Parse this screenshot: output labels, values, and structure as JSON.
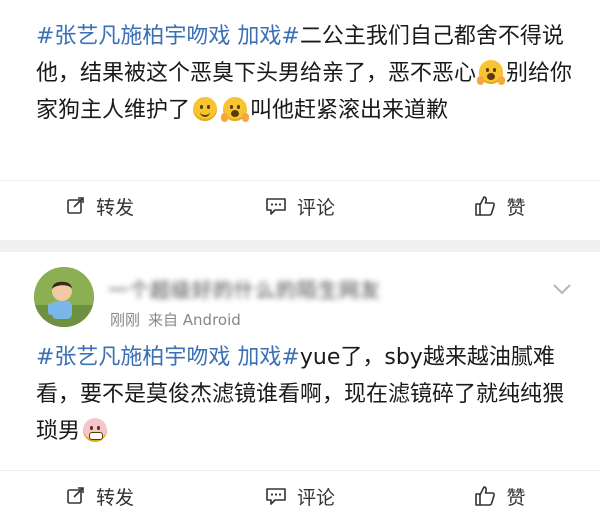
{
  "post1": {
    "tag": "#张艺凡施柏宇吻戏 加戏#",
    "text_a": "二公主我们自己都舍不得说他，结果被这个恶臭下头男给亲了，恶不恶心",
    "text_b": "别给你家狗主人维护了",
    "text_c": "叫他赶紧滚出来道歉",
    "actions": {
      "repost": "转发",
      "comment": "评论",
      "like": "赞"
    }
  },
  "post2": {
    "username": "一个超级好的什么的陌生网友",
    "time": "刚刚",
    "source": "来自 Android",
    "tag": "#张艺凡施柏宇吻戏 加戏#",
    "text": "yue了，sby越来越油腻难看，要不是莫俊杰滤镜谁看啊，现在滤镜碎了就纯纯猥琐男",
    "actions": {
      "repost": "转发",
      "comment": "评论",
      "like": "赞"
    }
  },
  "icons": {
    "repost": "repost-icon",
    "comment": "comment-icon",
    "like": "thumbs-up-icon",
    "more": "chevron-down-icon",
    "emoji_scream": "scream-emoji",
    "emoji_smile": "smile-emoji",
    "emoji_grimace": "grimace-emoji"
  },
  "colors": {
    "topic": "#3b6fb6",
    "meta": "#888888",
    "divider": "#f0f0f0"
  }
}
